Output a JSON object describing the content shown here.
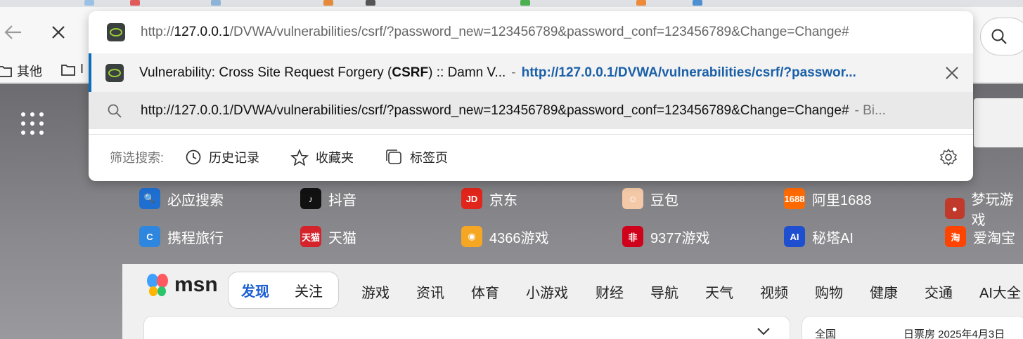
{
  "omnibox": {
    "input_prefix": "http://",
    "input_host": "127.0.0.1",
    "input_rest": "/DVWA/vulnerabilities/csrf/?password_new=123456789&password_conf=123456789&Change=Change#",
    "suggestion_history": {
      "title_pre": "Vulnerability: Cross Site Request Forgery (",
      "title_bold": "CSRF",
      "title_post": ") :: Damn V...",
      "separator": "-",
      "url": "http://127.0.0.1/DVWA/vulnerabilities/csrf/?passwor..."
    },
    "suggestion_search": {
      "text": "http://127.0.0.1/DVWA/vulnerabilities/csrf/?password_new=123456789&password_conf=123456789&Change=Change#",
      "suffix": "- Bi..."
    },
    "filter": {
      "label": "筛选搜索:",
      "history": "历史记录",
      "favorites": "收藏夹",
      "tabs": "标签页"
    }
  },
  "bookmarks": {
    "other": "其他",
    "second_partial": "I"
  },
  "quick_links": [
    {
      "label": "必应搜索",
      "color": "#1f6fd1",
      "glyph": "🔍"
    },
    {
      "label": "抖音",
      "color": "#111111",
      "glyph": "♪"
    },
    {
      "label": "京东",
      "color": "#e1251b",
      "glyph": "JD"
    },
    {
      "label": "豆包",
      "color": "#f3c9a8",
      "glyph": "☺"
    },
    {
      "label": "阿里1688",
      "color": "#ff6a00",
      "glyph": "1688"
    },
    {
      "label": "梦玩游戏",
      "color": "#c0392b",
      "glyph": "●"
    },
    {
      "label": "携程旅行",
      "color": "#2e86de",
      "glyph": "C"
    },
    {
      "label": "天猫",
      "color": "#d4232b",
      "glyph": "天猫"
    },
    {
      "label": "4366游戏",
      "color": "#f5a623",
      "glyph": "◉"
    },
    {
      "label": "9377游戏",
      "color": "#d0021b",
      "glyph": "非"
    },
    {
      "label": "秘塔AI",
      "color": "#1f4fd1",
      "glyph": "AI"
    },
    {
      "label": "爱淘宝",
      "color": "#ff4400",
      "glyph": "淘"
    }
  ],
  "msn": {
    "brand": "msn",
    "tab_discover": "发现",
    "tab_follow": "关注",
    "nav": [
      "游戏",
      "资讯",
      "体育",
      "小游戏",
      "财经",
      "导航",
      "天气",
      "视频",
      "购物",
      "健康",
      "交通",
      "AI大全"
    ],
    "card2_left": "全国",
    "card2_right": "日票房 2025年4月3日"
  }
}
